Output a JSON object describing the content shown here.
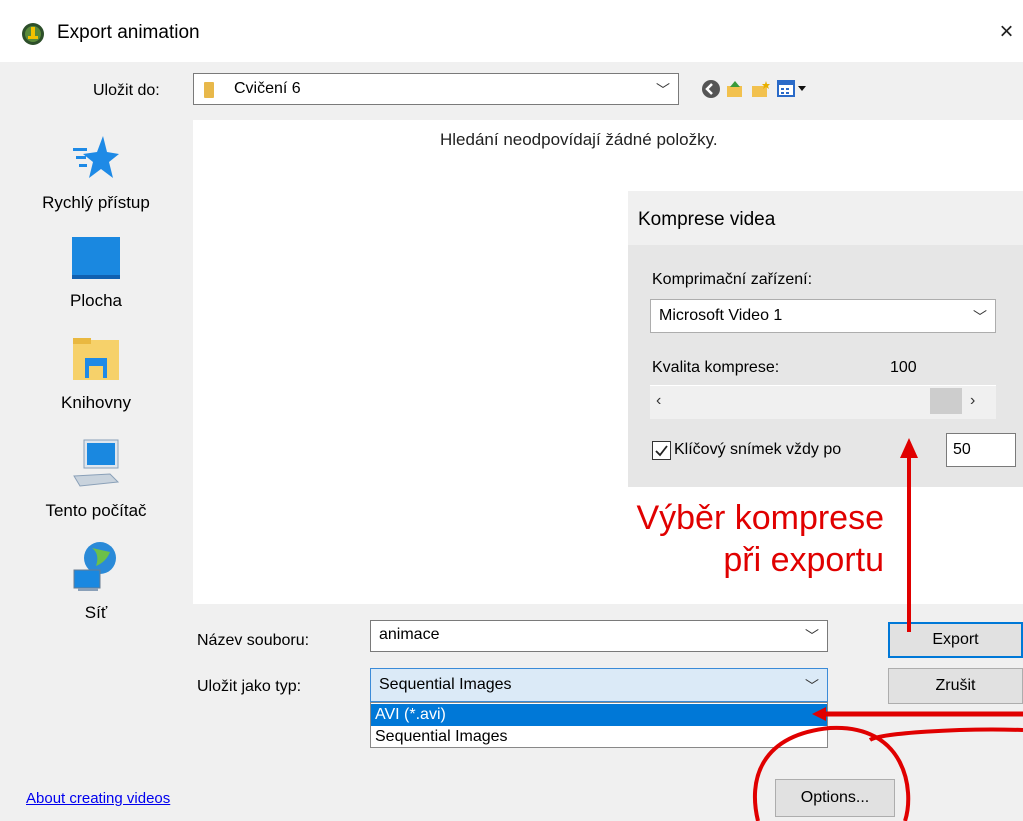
{
  "window": {
    "title": "Export animation",
    "close_glyph": "×"
  },
  "lookin": {
    "label": "Uložit do:",
    "value": "Cvičení 6"
  },
  "toolbar_icons": [
    "back-icon",
    "up-folder-icon",
    "new-folder-icon",
    "view-menu-icon"
  ],
  "places": [
    {
      "label": "Rychlý přístup",
      "icon": "quick-access-star-icon"
    },
    {
      "label": "Plocha",
      "icon": "desktop-icon"
    },
    {
      "label": "Knihovny",
      "icon": "libraries-icon"
    },
    {
      "label": "Tento počítač",
      "icon": "this-pc-icon"
    },
    {
      "label": "Síť",
      "icon": "network-icon"
    }
  ],
  "filelist": {
    "empty_message": "Hledání neodpovídají žádné položky."
  },
  "compression": {
    "title": "Komprese videa",
    "device_label": "Komprimační zařízení:",
    "device_value": "Microsoft Video 1",
    "quality_label": "Kvalita komprese:",
    "quality_value": "100",
    "keyframe_label": "Klíčový snímek vždy po",
    "keyframe_checked": true,
    "keyframe_value": "50"
  },
  "annotation": {
    "line1": "Výběr komprese",
    "line2": "při exportu",
    "color": "#e00000"
  },
  "form": {
    "filename_label": "Název souboru:",
    "filename_value": "animace",
    "filetype_label": "Uložit jako typ:",
    "filetype_value": "Sequential Images",
    "filetype_options": [
      "AVI (*.avi)",
      "Sequential Images"
    ],
    "filetype_highlighted": "AVI (*.avi)"
  },
  "buttons": {
    "export": "Export",
    "cancel": "Zrušit",
    "options": "Options..."
  },
  "links": {
    "about": "About creating videos"
  },
  "colors": {
    "accent": "#0078d7",
    "annotation_red": "#e00000",
    "dialog_bg": "#f0f0f0"
  }
}
